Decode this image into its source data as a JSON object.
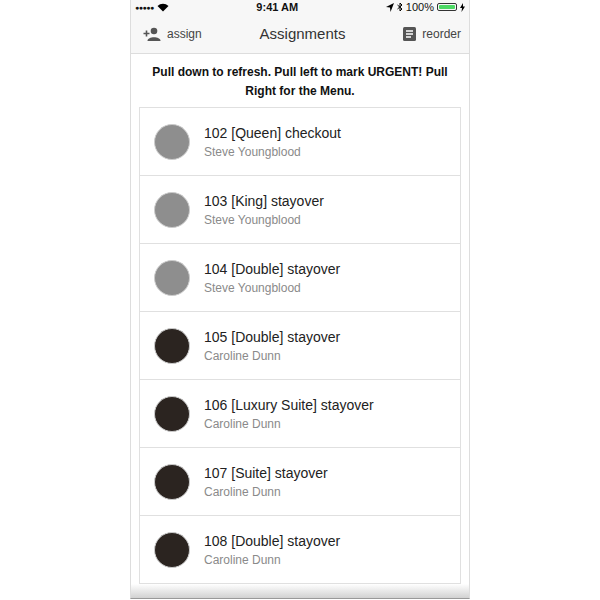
{
  "status_bar": {
    "signal": "●●●●●",
    "time": "9:41 AM",
    "battery": "100%",
    "battery_level": 1.0
  },
  "nav_bar": {
    "left_button": "assign",
    "title": "Assignments",
    "right_button": "reorder"
  },
  "instructions": "Pull down to refresh. Pull left to mark URGENT! Pull Right for the Menu.",
  "assignments": [
    {
      "title": "102 [Queen] checkout",
      "assignee": "Steve Youngblood",
      "color": "#8e8e8e"
    },
    {
      "title": "103 [King] stayover",
      "assignee": "Steve Youngblood",
      "color": "#8e8e8e"
    },
    {
      "title": "104 [Double] stayover",
      "assignee": "Steve Youngblood",
      "color": "#8e8e8e"
    },
    {
      "title": "105 [Double] stayover",
      "assignee": "Caroline Dunn",
      "color": "#2b2420"
    },
    {
      "title": "106 [Luxury Suite] stayover",
      "assignee": "Caroline Dunn",
      "color": "#2b2420"
    },
    {
      "title": "107 [Suite] stayover",
      "assignee": "Caroline Dunn",
      "color": "#2b2420"
    },
    {
      "title": "108 [Double] stayover",
      "assignee": "Caroline Dunn",
      "color": "#2b2420"
    }
  ]
}
